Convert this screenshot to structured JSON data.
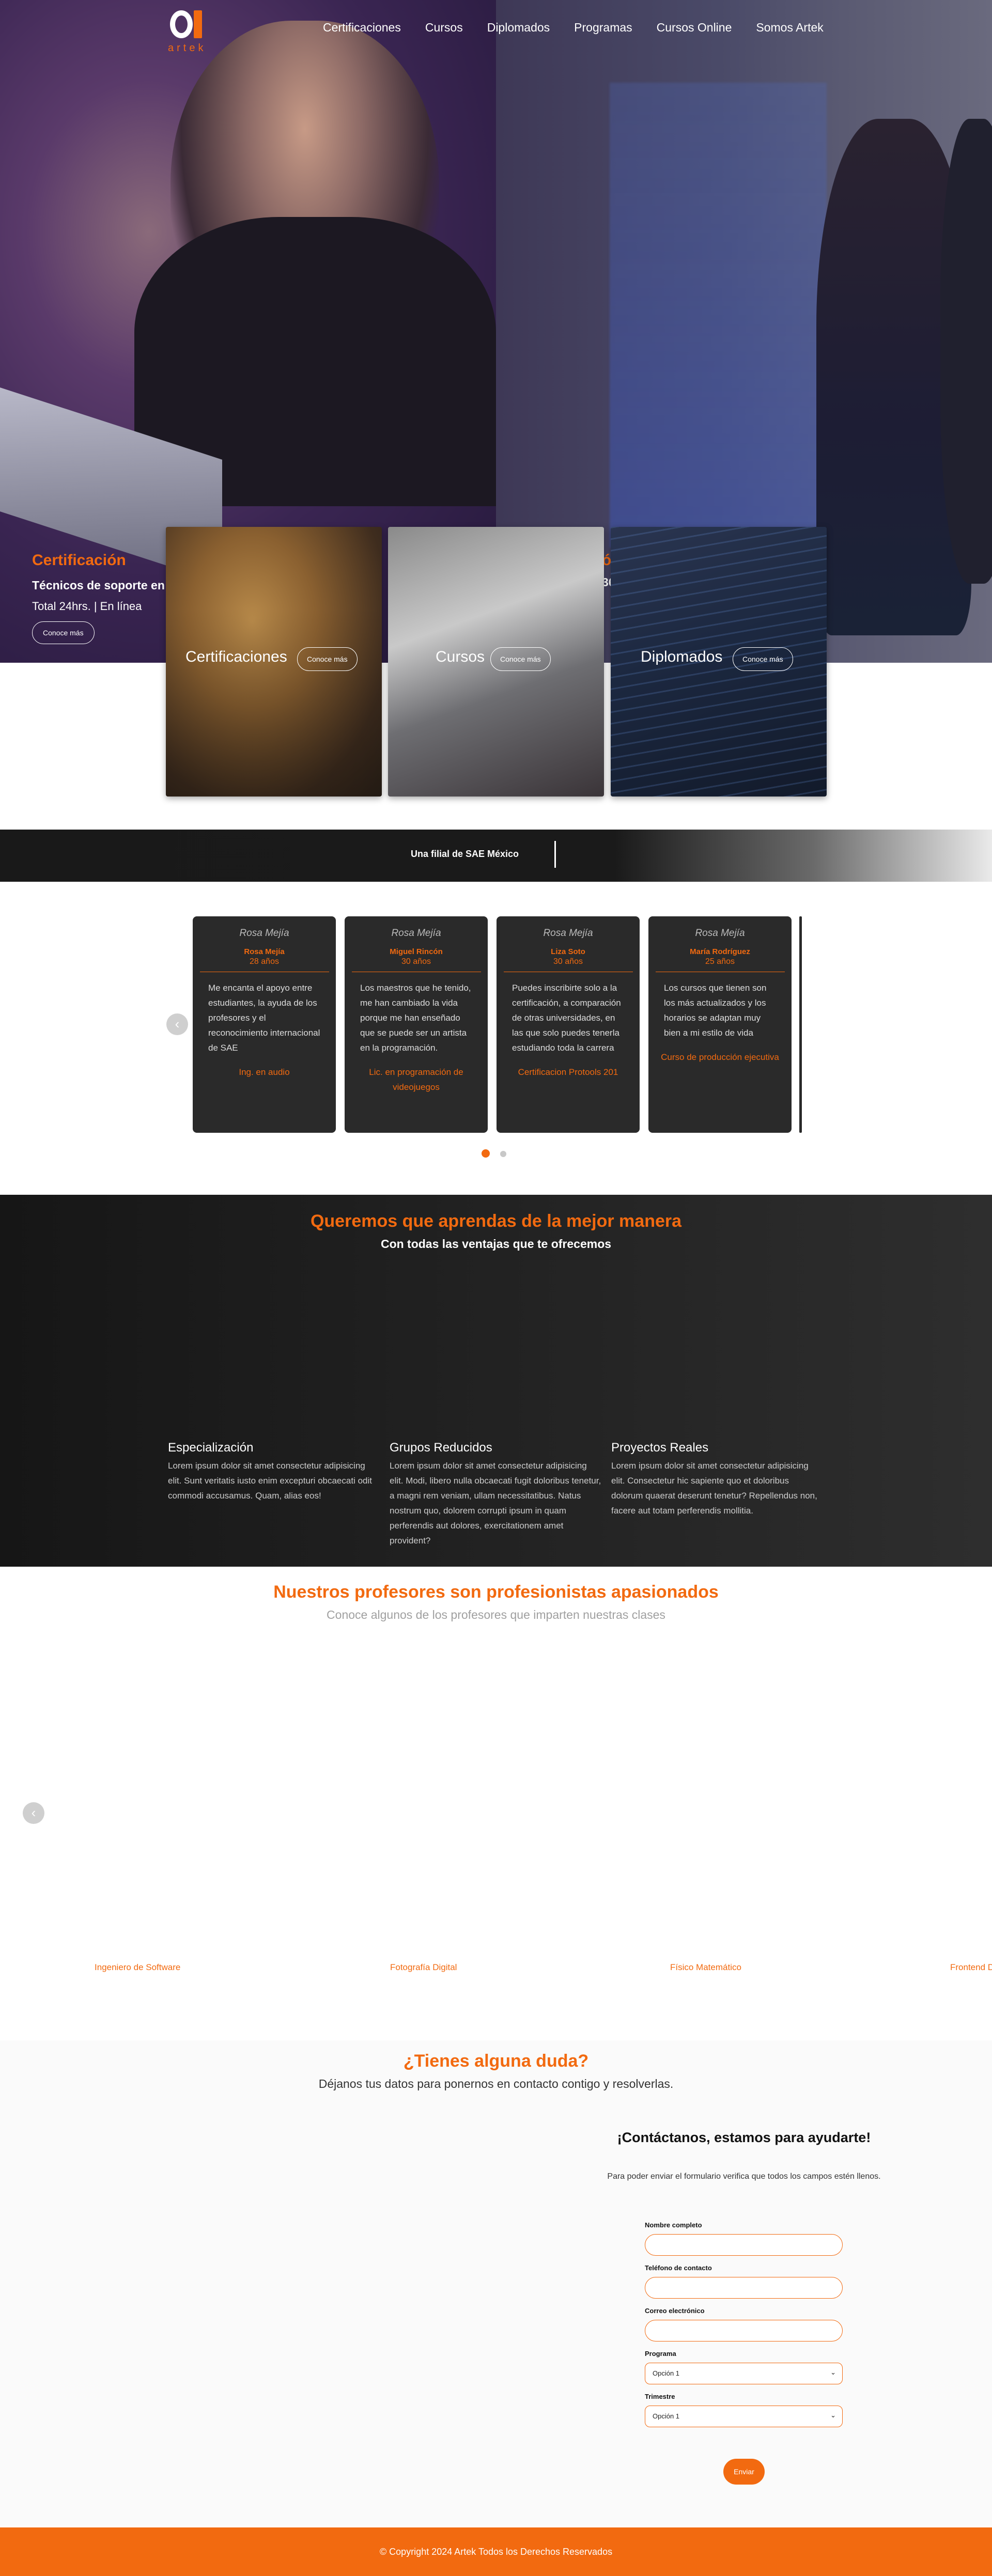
{
  "brand": {
    "logo_text": "artek",
    "accent": "#f26a10"
  },
  "nav": {
    "items": [
      "Certificaciones",
      "Cursos",
      "Diplomados",
      "Programas",
      "Cursos Online",
      "Somos Artek"
    ]
  },
  "hero": {
    "slide1": {
      "title": "Certificación",
      "subtitle": "Técnicos de soporte en c",
      "detail": "Total 24hrs. | En línea",
      "button": "Conoce más"
    },
    "slide2": {
      "title": "ó",
      "subtitle": "36"
    }
  },
  "categories": [
    {
      "label": "Certificaciones",
      "button": "Conoce más"
    },
    {
      "label": "Cursos",
      "button": "Conoce más"
    },
    {
      "label": "Diplomados",
      "button": "Conoce más"
    }
  ],
  "strip": {
    "text": "Una filial de SAE México"
  },
  "testimonials": [
    {
      "name": "Rosa Mejía",
      "small_name": "Rosa Mejía",
      "age": "28 años",
      "quote": "Me encanta el apoyo entre estudiantes, la ayuda de los profesores y el reconocimiento internacional de SAE",
      "role": "Ing. en audio"
    },
    {
      "name": "Rosa Mejía",
      "small_name": "Miguel Rincón",
      "age": "30 años",
      "quote": "Los maestros que he tenido, me han cambiado la vida porque me han enseñado que se puede ser un artista en la programación.",
      "role": "Lic. en programación de videojuegos"
    },
    {
      "name": "Rosa Mejía",
      "small_name": "Liza Soto",
      "age": "30 años",
      "quote": "Puedes inscribirte solo a la certificación, a comparación de otras universidades, en las que solo puedes tenerla estudiando toda la carrera",
      "role": "Certificacion Protools 201"
    },
    {
      "name": "Rosa Mejía",
      "small_name": "María Rodríguez",
      "age": "25 años",
      "quote": "Los cursos que tienen son los más actualizados y los horarios se adaptan muy bien a mi estilo de vida",
      "role": "Curso de producción ejecutiva"
    }
  ],
  "features": {
    "title": "Queremos que aprendas de la mejor manera",
    "subtitle": "Con todas las ventajas que te ofrecemos",
    "items": [
      {
        "title": "Especialización",
        "text": "Lorem ipsum dolor sit amet consectetur adipisicing elit. Sunt veritatis iusto enim excepturi obcaecati odit commodi accusamus. Quam, alias eos!"
      },
      {
        "title": "Grupos Reducidos",
        "text": "Lorem ipsum dolor sit amet consectetur adipisicing elit. Modi, libero nulla obcaecati fugit doloribus tenetur, a magni rem veniam, ullam necessitatibus. Natus nostrum quo, dolorem corrupti ipsum in quam perferendis aut dolores, exercitationem amet provident?"
      },
      {
        "title": "Proyectos Reales",
        "text": "Lorem ipsum dolor sit amet consectetur adipisicing elit. Consectetur hic sapiente quo et doloribus dolorum quaerat deserunt tenetur? Repellendus non, facere aut totam perferendis mollitia."
      }
    ]
  },
  "teachers": {
    "title": "Nuestros profesores son profesionistas apasionados",
    "subtitle": "Conoce algunos de los profesores que imparten nuestras clases",
    "roles": [
      "Ingeniero de Software",
      "Fotografía Digital",
      "Físico Matemático",
      "Frontend D"
    ]
  },
  "contact": {
    "title": "¿Tienes alguna duda?",
    "subtitle": "Déjanos tus datos para ponernos en contacto contigo y resolverlas.",
    "form_title": "¡Contáctanos, estamos para ayudarte!",
    "form_note": "Para poder enviar el formulario verifica que todos los campos estén llenos.",
    "labels": {
      "name": "Nombre completo",
      "phone": "Teléfono de contacto",
      "email": "Correo electrónico",
      "program": "Programa",
      "term": "Trimestre"
    },
    "program_value": "Opción 1",
    "term_value": "Opción 1",
    "submit": "Enviar"
  },
  "footer": {
    "text": "© Copyright 2024 Artek Todos los Derechos Reservados"
  }
}
